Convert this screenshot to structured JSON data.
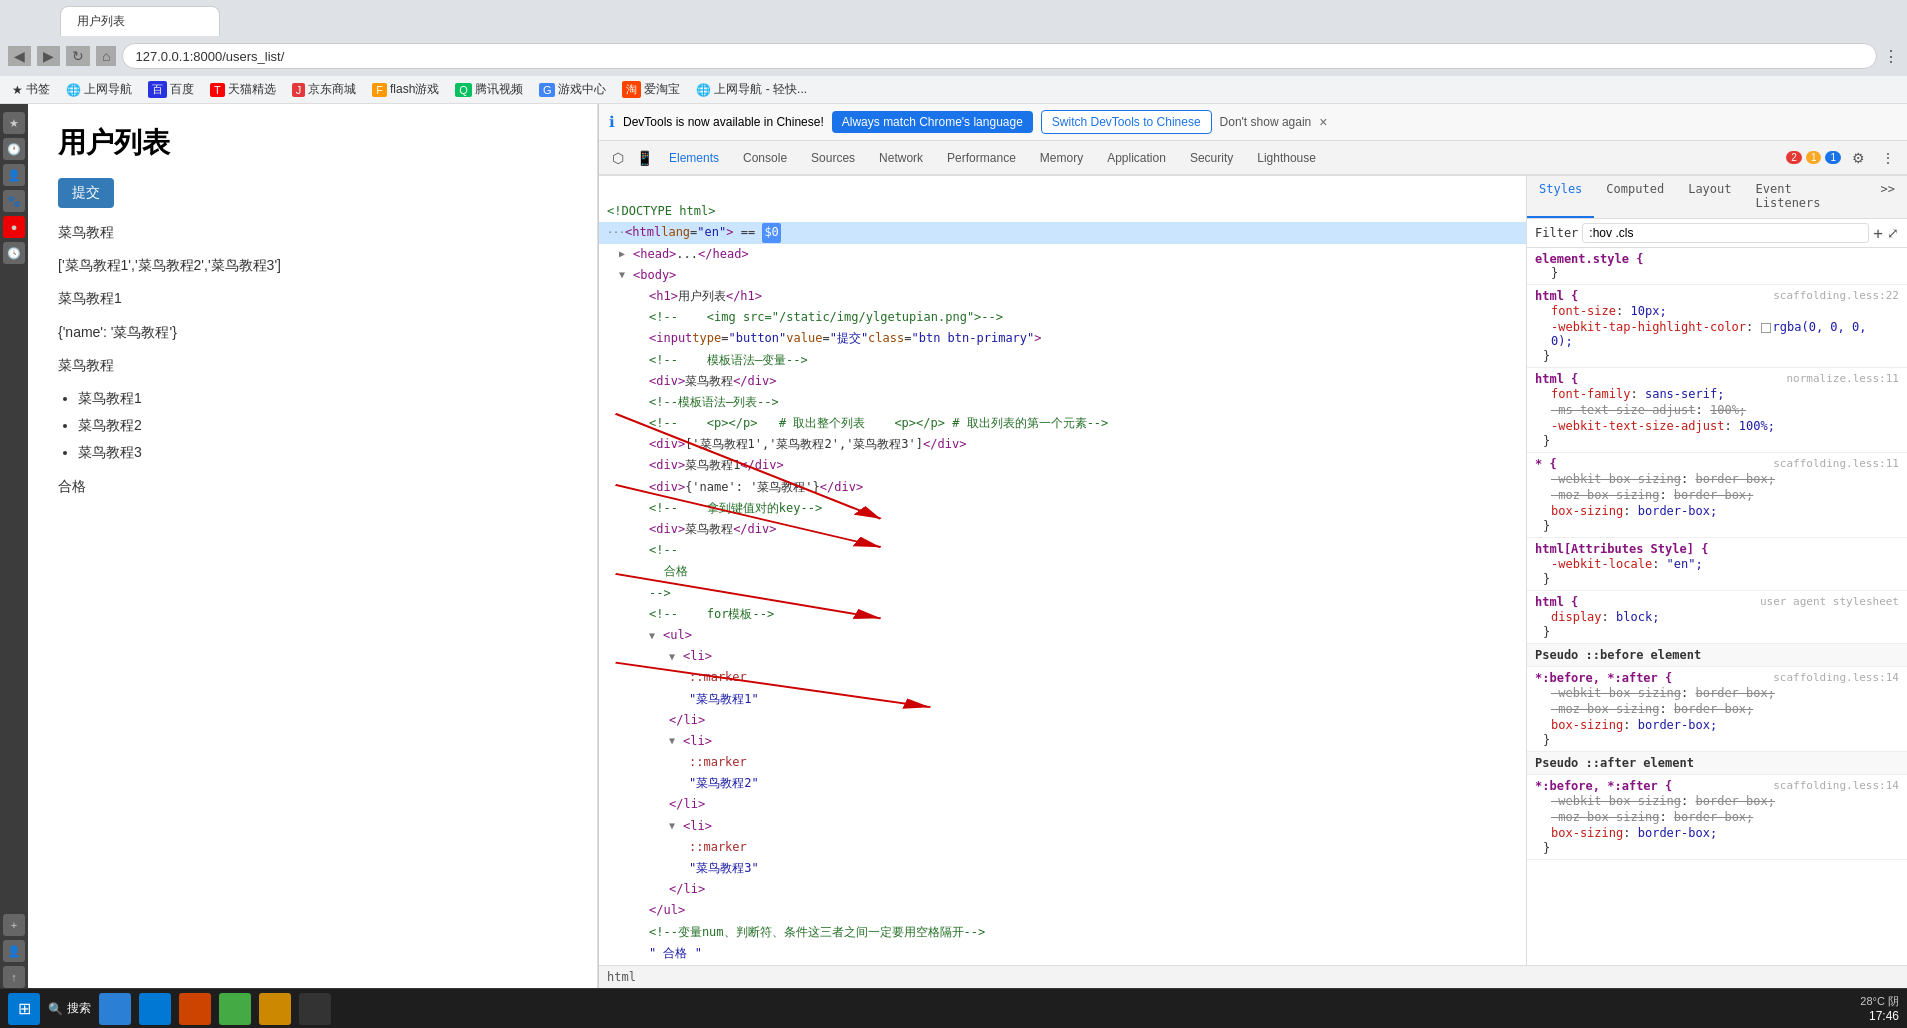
{
  "browser": {
    "address": "127.0.0.1:8000/users_list/",
    "tab_title": "用户列表",
    "back_icon": "◀",
    "fwd_icon": "▶",
    "reload_icon": "↻",
    "home_icon": "⌂"
  },
  "bookmarks": [
    {
      "label": "书签",
      "icon": "★"
    },
    {
      "label": "上网导航",
      "icon": "🌐"
    },
    {
      "label": "百度",
      "icon": "B"
    },
    {
      "label": "天猫精选",
      "icon": "T"
    },
    {
      "label": "京东商城",
      "icon": "J"
    },
    {
      "label": "flash游戏",
      "icon": "F"
    },
    {
      "label": "腾讯视频",
      "icon": "Q"
    },
    {
      "label": "游戏中心",
      "icon": "G"
    },
    {
      "label": "爱淘宝",
      "icon": "A"
    },
    {
      "label": "上网导航 - 轻快...",
      "icon": "🌐"
    }
  ],
  "page": {
    "title": "用户列表",
    "submit_btn": "提交",
    "sections": [
      "菜鸟教程",
      "['菜鸟教程1','菜鸟教程2','菜鸟教程3']",
      "菜鸟教程1",
      "{'name': '菜鸟教程'}",
      "菜鸟教程"
    ],
    "list_items": [
      "菜鸟教程1",
      "菜鸟教程2",
      "菜鸟教程3"
    ],
    "footer": "合格"
  },
  "devtools": {
    "notification": {
      "text": "DevTools is now available in Chinese!",
      "btn_match": "Always match Chrome's language",
      "btn_switch": "Switch DevTools to Chinese",
      "dont_show": "Don't show again",
      "close": "×"
    },
    "tabs": [
      {
        "label": "Elements",
        "active": true
      },
      {
        "label": "Console"
      },
      {
        "label": "Sources"
      },
      {
        "label": "Network"
      },
      {
        "label": "Performance"
      },
      {
        "label": "Memory"
      },
      {
        "label": "Application"
      },
      {
        "label": "Security"
      },
      {
        "label": "Lighthouse"
      }
    ],
    "badges": {
      "error_count": "2",
      "warn_count": "1",
      "info_count": "1"
    },
    "styles_tabs": [
      "Styles",
      "Computed",
      "Layout",
      "Event Listeners"
    ],
    "filter_placeholder": ":hov .cls",
    "html_lines": [
      {
        "indent": 0,
        "content": "<!---->",
        "type": "comment"
      },
      {
        "indent": 0,
        "content": "<!DOCTYPE html>",
        "type": "comment"
      },
      {
        "indent": 0,
        "content": "<html lang=\"en\"> == $0",
        "type": "tag",
        "selected": true
      },
      {
        "indent": 1,
        "content": "▶<head>...</head>",
        "type": "tag"
      },
      {
        "indent": 1,
        "content": "▼<body>",
        "type": "tag"
      },
      {
        "indent": 2,
        "content": "<h1>用户列表</h1>",
        "type": "tag"
      },
      {
        "indent": 2,
        "content": "<!--    <img src=\"/static/img/ylgetupian.png\">-->",
        "type": "comment"
      },
      {
        "indent": 2,
        "content": "<input type=\"button\" value=\"提交\" class=\"btn btn-primary\">",
        "type": "tag"
      },
      {
        "indent": 2,
        "content": "<!--    模板语法—变量-->",
        "type": "comment"
      },
      {
        "indent": 2,
        "content": "<div>菜鸟教程</div>",
        "type": "tag"
      },
      {
        "indent": 2,
        "content": "<!--模板语法—列表-->",
        "type": "comment"
      },
      {
        "indent": 2,
        "content": "<!--    <p></p>   # 取出整个列表    <p></p> # 取出列表的第一个元素-->",
        "type": "comment"
      },
      {
        "indent": 2,
        "content": "<div>['菜鸟教程1','菜鸟教程2','菜鸟教程3']</div>",
        "type": "tag"
      },
      {
        "indent": 2,
        "content": "<div>菜鸟教程1</div>",
        "type": "tag"
      },
      {
        "indent": 2,
        "content": "<div>{'name': '菜鸟教程'}</div>",
        "type": "tag"
      },
      {
        "indent": 2,
        "content": "<!--    拿到键值对的key-->",
        "type": "comment"
      },
      {
        "indent": 2,
        "content": "<div>菜鸟教程</div>",
        "type": "tag"
      },
      {
        "indent": 2,
        "content": "<!--",
        "type": "comment"
      },
      {
        "indent": 2,
        "content": "合格",
        "type": "text"
      },
      {
        "indent": 2,
        "content": "-->",
        "type": "comment"
      },
      {
        "indent": 2,
        "content": "<!--    for模板-->",
        "type": "comment"
      },
      {
        "indent": 2,
        "content": "▼<ul>",
        "type": "tag"
      },
      {
        "indent": 3,
        "content": "▼<li>",
        "type": "tag"
      },
      {
        "indent": 4,
        "content": "::marker",
        "type": "pseudo"
      },
      {
        "indent": 4,
        "content": "\"菜鸟教程1\"",
        "type": "string"
      },
      {
        "indent": 3,
        "content": "</li>",
        "type": "tag"
      },
      {
        "indent": 3,
        "content": "▼<li>",
        "type": "tag"
      },
      {
        "indent": 4,
        "content": "::marker",
        "type": "pseudo"
      },
      {
        "indent": 4,
        "content": "\"菜鸟教程2\"",
        "type": "string"
      },
      {
        "indent": 3,
        "content": "</li>",
        "type": "tag"
      },
      {
        "indent": 3,
        "content": "▼<li>",
        "type": "tag"
      },
      {
        "indent": 4,
        "content": "::marker",
        "type": "pseudo"
      },
      {
        "indent": 4,
        "content": "\"菜鸟教程3\"",
        "type": "string"
      },
      {
        "indent": 3,
        "content": "</li>",
        "type": "tag"
      },
      {
        "indent": 2,
        "content": "</ul>",
        "type": "tag"
      },
      {
        "indent": 2,
        "content": "<!--变量num、判断符、条件这三者之间一定要用空格隔开-->",
        "type": "comment"
      },
      {
        "indent": 2,
        "content": "\" 合格 \"",
        "type": "string"
      }
    ],
    "styles": [
      {
        "selector": "element.style {",
        "source": "",
        "props": []
      },
      {
        "selector": "html {",
        "source": "scaffolding.less:22",
        "props": [
          {
            "name": "font-size",
            "val": "10px;",
            "strike": false
          },
          {
            "name": "-webkit-tap-highlight-color",
            "val": "rgba(0, 0, 0, 0);",
            "strike": false
          }
        ]
      },
      {
        "selector": "html {",
        "source": "normalize.less:11",
        "props": [
          {
            "name": "font-family",
            "val": "sans-serif;",
            "strike": false
          },
          {
            "name": "-ms-text-size-adjust",
            "val": "100%;",
            "strike": true
          },
          {
            "name": "-webkit-text-size-adjust",
            "val": "100%;",
            "strike": false
          }
        ]
      },
      {
        "selector": "* {",
        "source": "scaffolding.less:11",
        "props": [
          {
            "name": "-webkit-box-sizing",
            "val": "border-box;",
            "strike": true
          },
          {
            "name": "-moz-box-sizing",
            "val": "border-box;",
            "strike": true
          },
          {
            "name": "box-sizing",
            "val": "border-box;",
            "strike": false
          }
        ]
      },
      {
        "selector": "html[Attributes Style] {",
        "source": "",
        "props": [
          {
            "name": "-webkit-locale",
            "val": "\"en\";",
            "strike": false
          }
        ]
      },
      {
        "selector": "html {",
        "source": "user agent stylesheet",
        "props": [
          {
            "name": "display",
            "val": "block;",
            "strike": false
          }
        ]
      }
    ],
    "pseudo_before": {
      "label": "Pseudo ::before element",
      "selector": "*:before, *:after {",
      "source": "scaffolding.less:14",
      "props": [
        {
          "name": "-webkit-box-sizing",
          "val": "border-box;",
          "strike": true
        },
        {
          "name": "-moz-box-sizing",
          "val": "border-box;",
          "strike": true
        },
        {
          "name": "box-sizing",
          "val": "border-box;",
          "strike": false
        }
      ]
    },
    "pseudo_after": {
      "label": "Pseudo ::after element",
      "selector": "*:before, *:after {",
      "source": "scaffolding.less:14",
      "props": [
        {
          "name": "-webkit-box-sizing",
          "val": "border-box;",
          "strike": true
        },
        {
          "name": "-moz-box-sizing",
          "val": "border-box;",
          "strike": true
        },
        {
          "name": "box-sizing",
          "val": "border-box;",
          "strike": false
        }
      ]
    },
    "breadcrumb": "html"
  },
  "taskbar": {
    "time": "17:46",
    "temp": "28°C 阴"
  }
}
